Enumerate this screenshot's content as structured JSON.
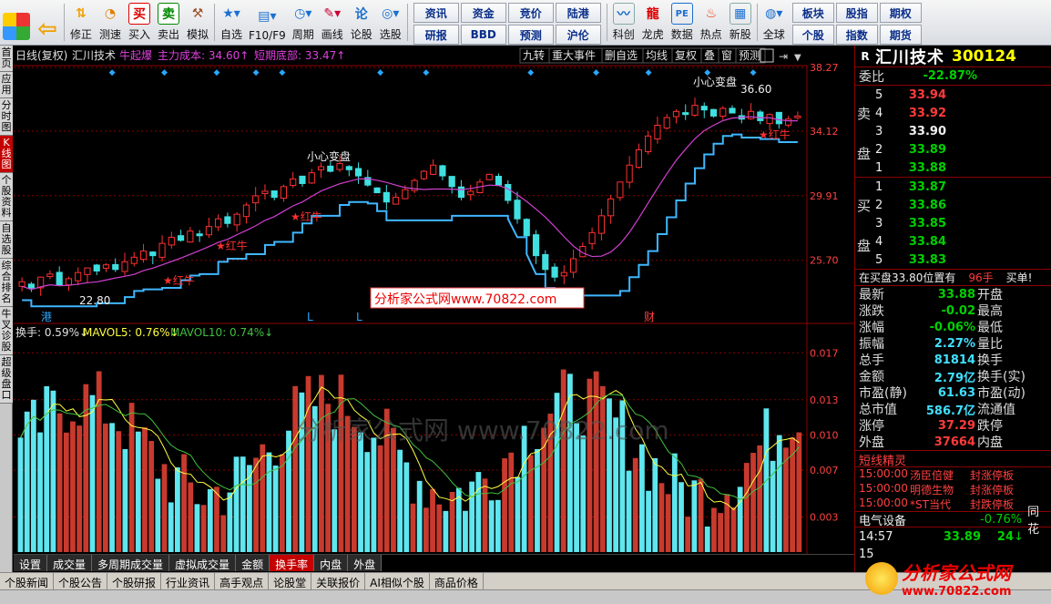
{
  "toolbar": {
    "buttons": [
      {
        "label": "修正",
        "icon": "up-down-arrows-icon"
      },
      {
        "label": "测速",
        "icon": "stopwatch-icon"
      },
      {
        "label": "买入",
        "icon": "buy-icon",
        "glyph": "买"
      },
      {
        "label": "卖出",
        "icon": "sell-icon",
        "glyph": "卖"
      },
      {
        "label": "模拟",
        "icon": "hammer-icon"
      },
      {
        "label": "自选",
        "icon": "star-folder-icon"
      },
      {
        "label": "F10/F9",
        "icon": "document-icon"
      },
      {
        "label": "周期",
        "icon": "cycle-icon"
      },
      {
        "label": "画线",
        "icon": "pencil-icon"
      },
      {
        "label": "论股",
        "icon": "discuss-icon"
      },
      {
        "label": "选股",
        "icon": "stock-picker-icon"
      }
    ],
    "grid1": [
      "资讯",
      "资金",
      "竞价",
      "陆港",
      "研报",
      "BBD",
      "预测",
      "沪伦"
    ],
    "buttons2": [
      {
        "label": "科创",
        "icon": "sci-tech-icon"
      },
      {
        "label": "龙虎",
        "icon": "dragon-tiger-icon"
      },
      {
        "label": "数据",
        "icon": "pe-data-icon"
      },
      {
        "label": "热点",
        "icon": "hot-icon"
      },
      {
        "label": "新股",
        "icon": "new-stock-icon"
      },
      {
        "label": "全球",
        "icon": "globe-icon"
      }
    ],
    "grid2": [
      "板块",
      "股指",
      "期权",
      "个股",
      "指数",
      "期货"
    ]
  },
  "left_tabs": [
    "首页",
    "应用",
    "分时图",
    "K线图",
    "个股资料",
    "自选股",
    "综合排名",
    "牛叉诊股",
    "超级盘口"
  ],
  "left_tabs_active": 3,
  "chart_header": {
    "period": "日线(复权)",
    "stock": "汇川技术",
    "indicator": "牛起爆",
    "main_cost": "主力成本: 34.60↑",
    "short_bottom": "短期底部: 33.47↑",
    "menu": [
      "九转",
      "重大事件",
      "删自选",
      "均线",
      "复权",
      "叠",
      "窗",
      "预测"
    ]
  },
  "chart_data": [
    {
      "type": "candlestick",
      "title": "汇川技术 日线(复权)",
      "y_ticks": [
        38.27,
        34.12,
        29.91,
        25.7
      ],
      "ylim": [
        22.0,
        38.27
      ],
      "annotations": [
        "小心变盘",
        "小心变盘",
        "36.60",
        "22.80",
        "红牛",
        "红牛",
        "红牛",
        "红牛"
      ],
      "markers": [
        "港",
        "L",
        "L",
        "财"
      ],
      "series": [
        {
          "name": "主力成本",
          "color": "#d040d0"
        },
        {
          "name": "短期底部",
          "color": "#3fb7ff"
        }
      ],
      "close_path": [
        24.3,
        23.9,
        24.6,
        24.8,
        24.1,
        24.5,
        24.9,
        25.2,
        25.0,
        25.4,
        25.1,
        25.6,
        25.9,
        26.3,
        26.0,
        26.8,
        27.2,
        27.0,
        27.6,
        27.3,
        27.9,
        28.4,
        28.1,
        28.7,
        29.3,
        29.9,
        30.2,
        29.8,
        30.5,
        31.0,
        30.7,
        31.4,
        31.8,
        31.5,
        32.0,
        31.6,
        31.2,
        30.6,
        30.1,
        29.5,
        29.8,
        30.3,
        30.9,
        31.5,
        31.9,
        31.2,
        30.5,
        29.8,
        30.2,
        30.8,
        31.3,
        30.6,
        29.6,
        28.4,
        27.3,
        26.0,
        25.1,
        24.6,
        24.9,
        25.8,
        26.6,
        27.5,
        28.6,
        29.7,
        30.8,
        31.9,
        32.9,
        33.8,
        34.5,
        35.0,
        35.4,
        35.2,
        35.8,
        35.5,
        35.1,
        35.6,
        35.3,
        34.9,
        35.4,
        34.8,
        35.2,
        34.6,
        34.9,
        35.1
      ]
    },
    {
      "type": "bar",
      "title": "换手",
      "ylabel": "换手",
      "y_ticks": [
        0.017,
        0.013,
        0.01,
        0.007,
        0.003
      ],
      "ylim": [
        0,
        0.0185
      ],
      "series": [
        {
          "name": "换手",
          "value_label": "0.59%"
        },
        {
          "name": "MAVOL5",
          "value_label": "0.76%"
        },
        {
          "name": "MAVOL10",
          "value_label": "0.74%"
        }
      ]
    }
  ],
  "volume_header": {
    "turnover": "换手: 0.59%↓",
    "mavol5": "MAVOL5: 0.76%↓",
    "mavol10": "MAVOL10: 0.74%↓"
  },
  "watermark_center": "分析家公式网www.70822.com",
  "watermark_mid": "分析家公式网 www.70822.com",
  "right_panel": {
    "r_label": "R",
    "name": "汇川技术",
    "code": "300124",
    "weibi_label": "委比",
    "weibi_value": "-22.87%",
    "sell_label": "卖盘",
    "buy_label": "买盘",
    "sell": [
      {
        "n": "5",
        "price": "33.94"
      },
      {
        "n": "4",
        "price": "33.92"
      },
      {
        "n": "3",
        "price": "33.90"
      },
      {
        "n": "2",
        "price": "33.89"
      },
      {
        "n": "1",
        "price": "33.88"
      }
    ],
    "buy": [
      {
        "n": "1",
        "price": "33.87"
      },
      {
        "n": "2",
        "price": "33.86"
      },
      {
        "n": "3",
        "price": "33.85"
      },
      {
        "n": "4",
        "price": "33.84"
      },
      {
        "n": "5",
        "price": "33.83"
      }
    ],
    "position_note": "在买盘33.80位置有",
    "position_qty": "96手",
    "position_tag": "买单!",
    "stats": [
      {
        "k": "最新",
        "v": "33.88",
        "k2": "开盘",
        "color": "c-green"
      },
      {
        "k": "涨跌",
        "v": "-0.02",
        "k2": "最高",
        "color": "c-green"
      },
      {
        "k": "涨幅",
        "v": "-0.06%",
        "k2": "最低",
        "color": "c-green"
      },
      {
        "k": "振幅",
        "v": "2.27%",
        "k2": "量比",
        "color": "c-cyan"
      },
      {
        "k": "总手",
        "v": "81814",
        "k2": "换手",
        "color": "c-cyan"
      },
      {
        "k": "金额",
        "v": "2.79亿",
        "k2": "换手(实)",
        "color": "c-cyan"
      },
      {
        "k": "市盈(静)",
        "v": "61.63",
        "k2": "市盈(动)",
        "color": "c-cyan"
      },
      {
        "k": "总市值",
        "v": "586.7亿",
        "k2": "流通值",
        "color": "c-cyan"
      },
      {
        "k": "涨停",
        "v": "37.29",
        "k2": "跌停",
        "color": "c-red"
      },
      {
        "k": "外盘",
        "v": "37664",
        "k2": "内盘",
        "color": "c-red"
      }
    ],
    "elf_title": "短线精灵",
    "elf": [
      {
        "t": "15:00:00",
        "s": "汤臣倍健",
        "e": "封涨停板"
      },
      {
        "t": "15:00:00",
        "s": "明德生物",
        "e": "封涨停板"
      },
      {
        "t": "15:00:00",
        "s": "*ST当代",
        "e": "封跌停板"
      }
    ],
    "sector": "电气设备",
    "sector_change": "-0.76%",
    "sector_tail": "同花",
    "last_time": "14:57",
    "last_price": "33.89",
    "last_vol": "24",
    "last_vol_tail": "↓",
    "second_time": "15"
  },
  "sub_tabs": [
    "设置",
    "成交量",
    "多周期成交量",
    "虚拟成交量",
    "金额",
    "换手率",
    "内盘",
    "外盘"
  ],
  "sub_tabs_active": 5,
  "news_tabs": [
    "个股新闻",
    "个股公告",
    "个股研报",
    "行业资讯",
    "高手观点",
    "论股堂",
    "关联报价",
    "AI相似个股",
    "商品价格"
  ],
  "brand": {
    "name": "分析家公式网",
    "url": "www.70822.com"
  }
}
